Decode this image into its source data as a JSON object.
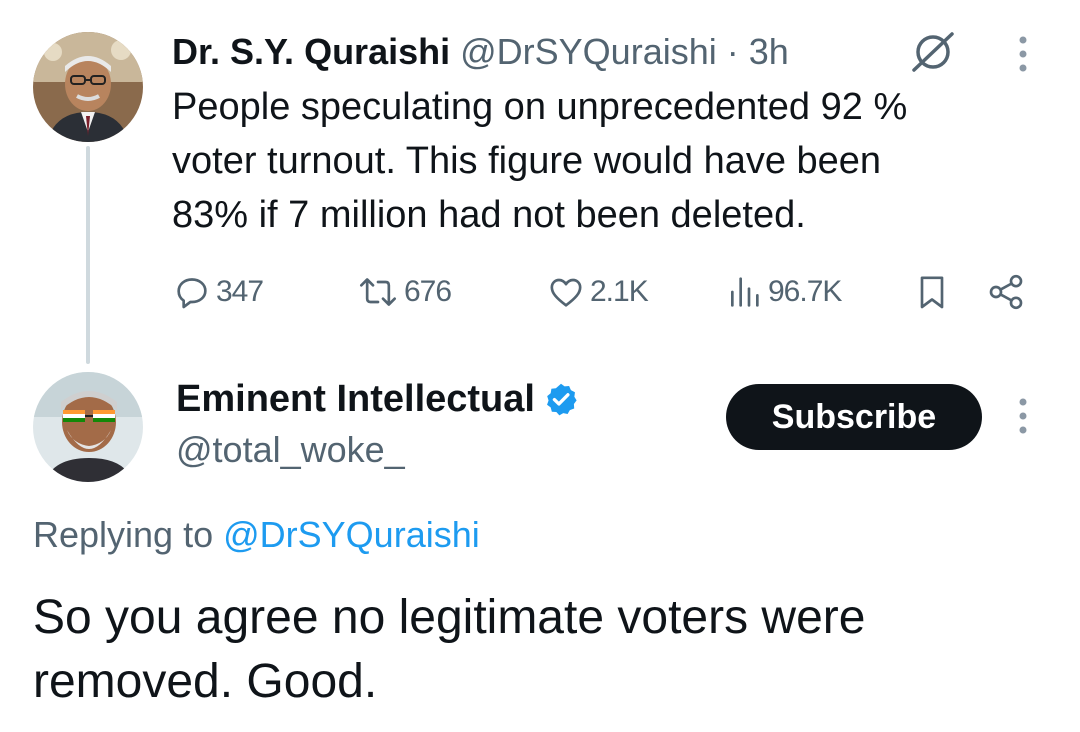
{
  "original_tweet": {
    "author_name": "Dr. S.Y. Quraishi",
    "author_handle": "@DrSYQuraishi",
    "separator": "·",
    "time_ago": "3h",
    "text": "People speculating on unprecedented 92 %\nvoter turnout. This figure would have been\n83% if 7 million had not been deleted.",
    "stats": {
      "replies": "347",
      "reposts": "676",
      "likes": "2.1K",
      "views": "96.7K"
    },
    "icons": {
      "avatar": "profile-photo-man-glasses",
      "grok": "grok-icon",
      "more": "more-vertical-icon",
      "reply": "speech-bubble-icon",
      "repost": "repost-arrows-icon",
      "like": "heart-icon",
      "views": "bar-chart-icon",
      "bookmark": "bookmark-icon",
      "share": "share-icon"
    }
  },
  "reply_tweet": {
    "author_name": "Eminent Intellectual",
    "author_handle": "@total_woke_",
    "verified": true,
    "subscribe_label": "Subscribe",
    "replying_prefix": "Replying to",
    "replying_to_handle": "@DrSYQuraishi",
    "text": "So you agree no legitimate voters were\nremoved. Good.",
    "icons": {
      "avatar": "profile-photo-man-beard-tricolor-glasses",
      "verified": "verified-badge-icon",
      "more": "more-vertical-icon"
    }
  },
  "colors": {
    "text_primary": "#0f1419",
    "text_secondary": "#536471",
    "link": "#1d9bf0",
    "verified": "#1d9bf0",
    "button_bg": "#0f1419",
    "button_text": "#ffffff",
    "thread_line": "#cfd9de"
  }
}
